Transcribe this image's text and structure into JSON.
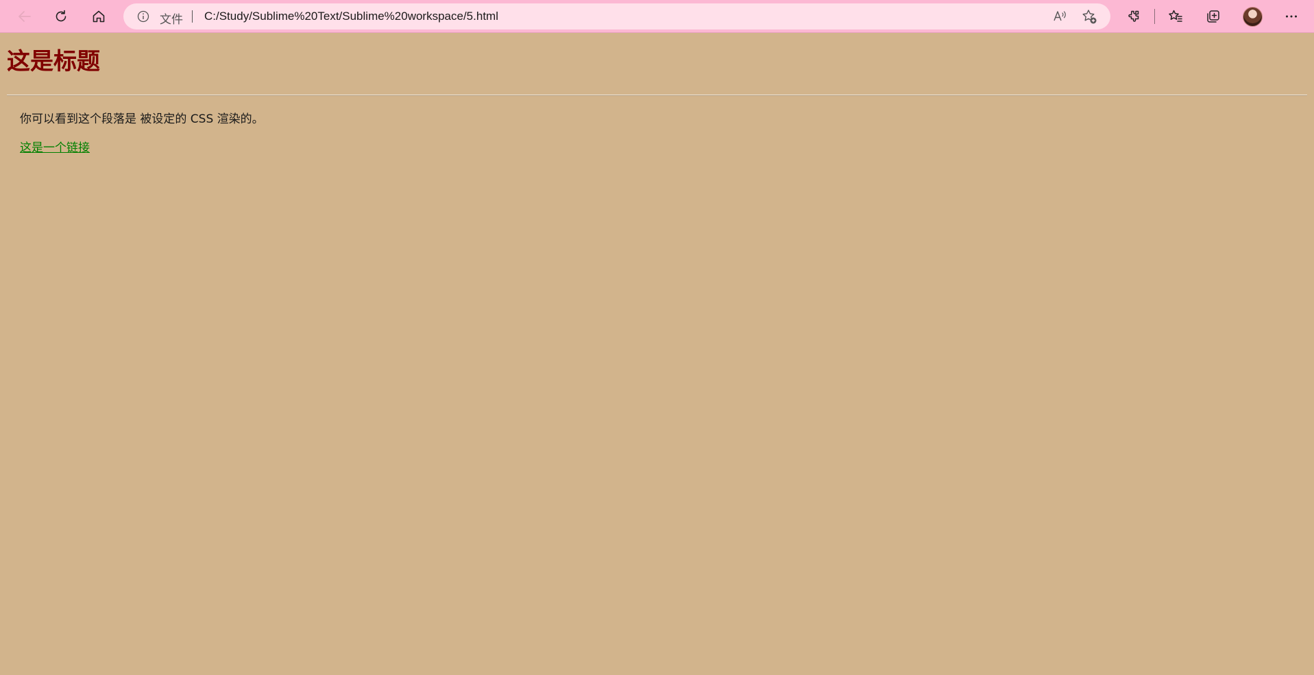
{
  "browser": {
    "address_prefix": "文件",
    "url": "C:/Study/Sublime%20Text/Sublime%20workspace/5.html",
    "toolbar_color": "#fcb8d3",
    "address_bar_color": "#ffe0ea",
    "icons": {
      "back": "back-arrow-icon",
      "refresh": "refresh-icon",
      "home": "home-icon",
      "info": "info-icon",
      "read_aloud": "read-aloud-icon",
      "add_favorite": "add-favorite-icon",
      "extensions": "extensions-icon",
      "favorites": "favorites-icon",
      "collections": "collections-icon",
      "profile": "profile-avatar",
      "more": "more-icon"
    }
  },
  "page": {
    "background_color": "#d2b48c",
    "heading": "这是标题",
    "heading_color": "#800000",
    "paragraph": "你可以看到这个段落是 被设定的 CSS 渲染的。",
    "link_text": "这是一个链接",
    "link_color": "#008000"
  }
}
